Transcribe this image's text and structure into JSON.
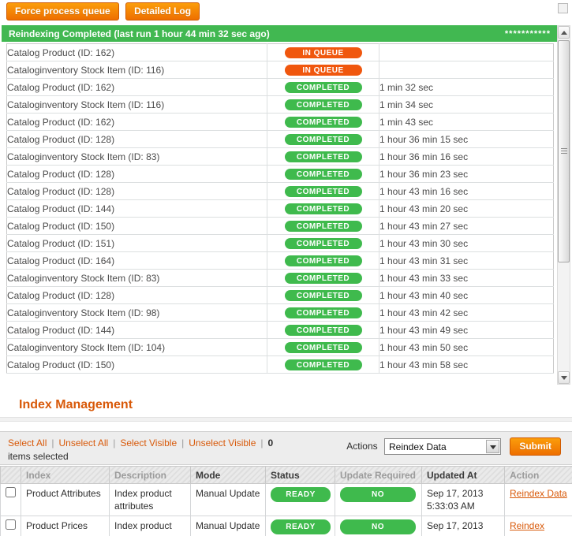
{
  "colors": {
    "accent_orange": "#EE6F00",
    "success_green": "#41B851",
    "badge_in_queue": "#F0570E",
    "badge_completed": "#3FBA4D",
    "link_orange": "#D85909"
  },
  "top_buttons": {
    "force_process_queue": "Force process queue",
    "detailed_log": "Detailed Log"
  },
  "log_panel": {
    "header": "Reindexing Completed (last run 1 hour 44 min 32 sec ago)",
    "header_right": "***********",
    "rows": [
      {
        "name": "Catalog Product (ID: 162)",
        "status": "IN QUEUE",
        "time": ""
      },
      {
        "name": "Cataloginventory Stock Item (ID: 116)",
        "status": "IN QUEUE",
        "time": ""
      },
      {
        "name": "Catalog Product (ID: 162)",
        "status": "COMPLETED",
        "time": "1 min 32 sec"
      },
      {
        "name": "Cataloginventory Stock Item (ID: 116)",
        "status": "COMPLETED",
        "time": "1 min 34 sec"
      },
      {
        "name": "Catalog Product (ID: 162)",
        "status": "COMPLETED",
        "time": "1 min 43 sec"
      },
      {
        "name": "Catalog Product (ID: 128)",
        "status": "COMPLETED",
        "time": "1 hour 36 min 15 sec"
      },
      {
        "name": "Cataloginventory Stock Item (ID: 83)",
        "status": "COMPLETED",
        "time": "1 hour 36 min 16 sec"
      },
      {
        "name": "Catalog Product (ID: 128)",
        "status": "COMPLETED",
        "time": "1 hour 36 min 23 sec"
      },
      {
        "name": "Catalog Product (ID: 128)",
        "status": "COMPLETED",
        "time": "1 hour 43 min 16 sec"
      },
      {
        "name": "Catalog Product (ID: 144)",
        "status": "COMPLETED",
        "time": "1 hour 43 min 20 sec"
      },
      {
        "name": "Catalog Product (ID: 150)",
        "status": "COMPLETED",
        "time": "1 hour 43 min 27 sec"
      },
      {
        "name": "Catalog Product (ID: 151)",
        "status": "COMPLETED",
        "time": "1 hour 43 min 30 sec"
      },
      {
        "name": "Catalog Product (ID: 164)",
        "status": "COMPLETED",
        "time": "1 hour 43 min 31 sec"
      },
      {
        "name": "Cataloginventory Stock Item (ID: 83)",
        "status": "COMPLETED",
        "time": "1 hour 43 min 33 sec"
      },
      {
        "name": "Catalog Product (ID: 128)",
        "status": "COMPLETED",
        "time": "1 hour 43 min 40 sec"
      },
      {
        "name": "Cataloginventory Stock Item (ID: 98)",
        "status": "COMPLETED",
        "time": "1 hour 43 min 42 sec"
      },
      {
        "name": "Catalog Product (ID: 144)",
        "status": "COMPLETED",
        "time": "1 hour 43 min 49 sec"
      },
      {
        "name": "Cataloginventory Stock Item (ID: 104)",
        "status": "COMPLETED",
        "time": "1 hour 43 min 50 sec"
      },
      {
        "name": "Catalog Product (ID: 150)",
        "status": "COMPLETED",
        "time": "1 hour 43 min 58 sec"
      }
    ]
  },
  "section": {
    "title": "Index Management"
  },
  "massactions": {
    "links": [
      "Select All",
      "Unselect All",
      "Select Visible",
      "Unselect Visible"
    ],
    "separator": "|",
    "selected_count": "0",
    "selected_label": "items selected",
    "actions_label": "Actions",
    "action_value": "Reindex Data",
    "submit_label": "Submit"
  },
  "grid": {
    "columns": [
      "",
      "Index",
      "Description",
      "Mode",
      "Status",
      "Update Required",
      "Updated At",
      "Action"
    ],
    "rows": [
      {
        "index": "Product Attributes",
        "description": "Index product attributes",
        "mode": "Manual Update",
        "status": "READY",
        "update_required": "NO",
        "updated_at": "Sep 17, 2013\n5:33:03 AM",
        "action": "Reindex Data"
      },
      {
        "index": "Product Prices",
        "description": "Index product",
        "mode": "Manual Update",
        "status": "READY",
        "update_required": "NO",
        "updated_at": "Sep 17, 2013",
        "action": "Reindex"
      }
    ]
  }
}
